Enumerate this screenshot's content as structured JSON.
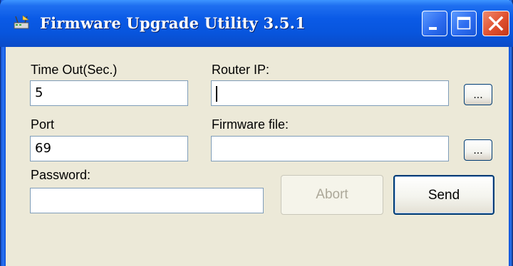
{
  "window": {
    "title": "Firmware Upgrade Utility 3.5.1"
  },
  "title_buttons": {
    "minimize_icon": "minimize-icon",
    "maximize_icon": "maximize-icon",
    "close_icon": "close-icon"
  },
  "form": {
    "timeout": {
      "label": "Time Out(Sec.)",
      "value": "5"
    },
    "router_ip": {
      "label": "Router IP:",
      "value": ""
    },
    "port": {
      "label": "Port",
      "value": "69"
    },
    "firmware_file": {
      "label": "Firmware file:",
      "value": ""
    },
    "password": {
      "label": "Password:",
      "value": ""
    },
    "browse_label": "...",
    "abort_label": "Abort",
    "send_label": "Send"
  },
  "colors": {
    "title_bar": "#0A5AE6",
    "window_bg": "#ECE9D8",
    "close_button": "#E0502E",
    "field_border": "#7F9DB9"
  }
}
